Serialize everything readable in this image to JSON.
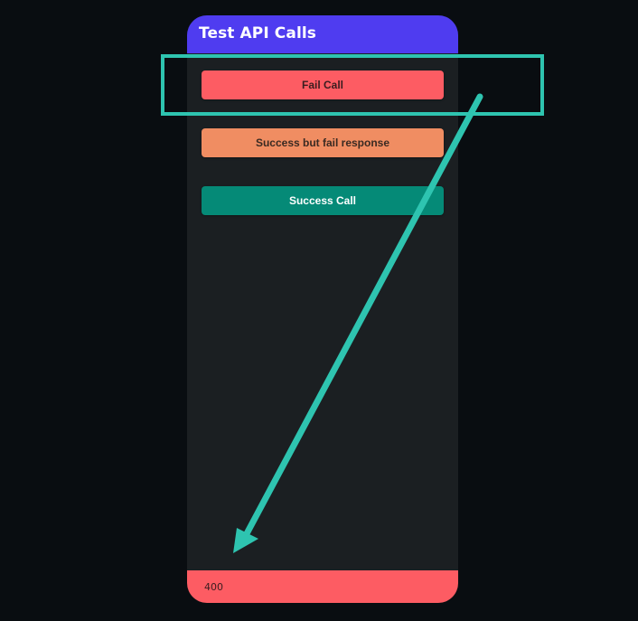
{
  "app": {
    "title": "Test API Calls"
  },
  "buttons": {
    "fail_call": "Fail Call",
    "success_fail_response": "Success but fail response",
    "success_call": "Success Call"
  },
  "status": {
    "value": "400"
  },
  "colors": {
    "background": "#090d11",
    "header": "#4f3cf0",
    "panel": "#1b1f22",
    "fail": "#fd5c63",
    "warning": "#f08d62",
    "success": "#058a77",
    "annotation": "#2ec4b0"
  }
}
